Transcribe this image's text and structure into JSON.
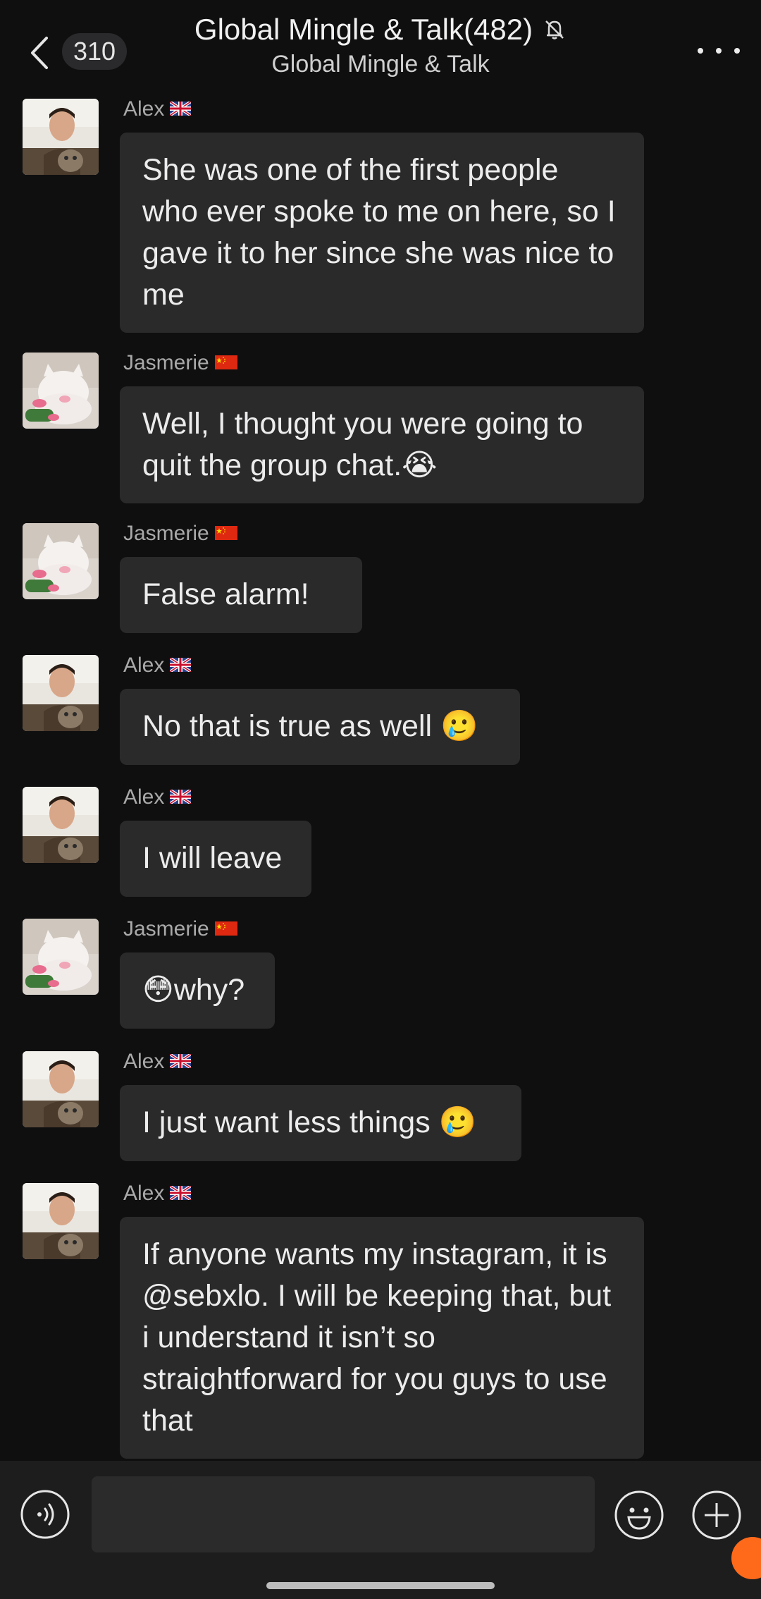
{
  "header": {
    "count": "310",
    "title": "Global Mingle & Talk(482)",
    "subtitle": "Global Mingle & Talk"
  },
  "messages": [
    {
      "sender": "Alex",
      "flag": "uk",
      "avatar": "man-with-cat",
      "text": "She was one of the first people who ever spoke to me on here, so I gave it to her since she was nice to me",
      "emoji": ""
    },
    {
      "sender": "Jasmerie",
      "flag": "cn",
      "avatar": "white-cat",
      "text": "Well, I thought you were going to quit the group chat.",
      "emoji": "😭"
    },
    {
      "sender": "Jasmerie",
      "flag": "cn",
      "avatar": "white-cat",
      "text": "False alarm!",
      "emoji": ""
    },
    {
      "sender": "Alex",
      "flag": "uk",
      "avatar": "man-with-cat",
      "text": "No that is true as well ",
      "emoji": "🥲"
    },
    {
      "sender": "Alex",
      "flag": "uk",
      "avatar": "man-with-cat",
      "text": "I will leave",
      "emoji": ""
    },
    {
      "sender": "Jasmerie",
      "flag": "cn",
      "avatar": "white-cat",
      "text": "why?",
      "emoji": "😳"
    },
    {
      "sender": "Alex",
      "flag": "uk",
      "avatar": "man-with-cat",
      "text": "I just want less things ",
      "emoji": "🥲"
    },
    {
      "sender": "Alex",
      "flag": "uk",
      "avatar": "man-with-cat",
      "text": "If anyone wants my instagram, it is @sebxlo. I will be keeping that, but i understand it isn’t so straightforward for you guys to use that",
      "emoji": ""
    }
  ],
  "icons": {
    "back": "chevron-left-icon",
    "mute": "bell-off-icon",
    "more": "more-dots-icon",
    "voice": "voice-icon",
    "emoji": "smiley-icon",
    "plus": "plus-icon"
  },
  "colors": {
    "background": "#0f0f10",
    "bubble": "#2a2a2b",
    "bottom_bar": "#1d1d1e",
    "badge": "#ff6a1a"
  }
}
